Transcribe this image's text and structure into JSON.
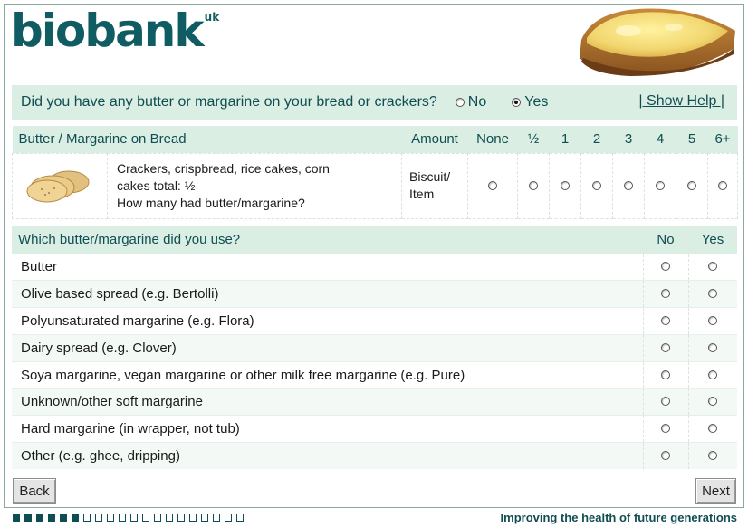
{
  "logo": {
    "text": "biobank",
    "superscript": "uk"
  },
  "question": {
    "text": "Did you have any butter or margarine on your bread or crackers?",
    "options": [
      {
        "label": "No",
        "checked": false
      },
      {
        "label": "Yes",
        "checked": true
      }
    ],
    "help_link": "| Show Help |"
  },
  "butter_table": {
    "headers": [
      "Butter / Margarine on Bread",
      "Amount",
      "None",
      "½",
      "1",
      "2",
      "3",
      "4",
      "5",
      "6+"
    ],
    "row": {
      "description_line1": "Crackers, crispbread, rice cakes, corn",
      "description_line2": "cakes total: ½",
      "description_line3": "How many had butter/margarine?",
      "amount_line1": "Biscuit/",
      "amount_line2": "Item",
      "image": "crackers-image"
    }
  },
  "type_table": {
    "header": "Which butter/margarine did you use?",
    "col_no": "No",
    "col_yes": "Yes",
    "rows": [
      "Butter",
      "Olive based spread (e.g. Bertolli)",
      "Polyunsaturated margarine (e.g. Flora)",
      "Dairy spread (e.g. Clover)",
      "Soya margarine, vegan margarine or other milk free margarine (e.g. Pure)",
      "Unknown/other soft margarine",
      "Hard margarine (in wrapper, not tub)",
      "Other (e.g. ghee, dripping)"
    ]
  },
  "buttons": {
    "back": "Back",
    "next": "Next"
  },
  "progress": {
    "completed": 6,
    "total": 20
  },
  "footer": {
    "tagline": "Improving the health of future generations"
  },
  "colors": {
    "brand": "#0f5c63",
    "header_bg": "#dbeee3",
    "alt_row": "#f3faf6"
  }
}
